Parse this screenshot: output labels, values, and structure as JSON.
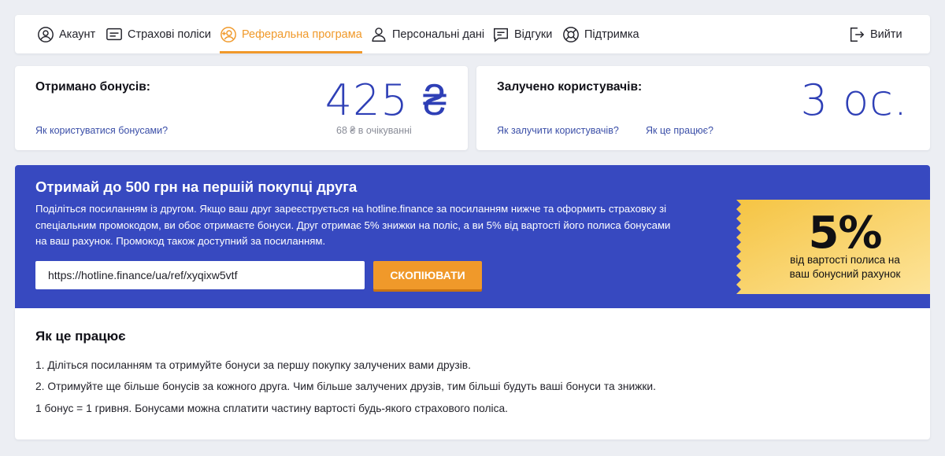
{
  "nav": {
    "items": [
      {
        "label": "Акаунт",
        "icon": "account-icon",
        "active": false
      },
      {
        "label": "Страхові поліси",
        "icon": "policies-icon",
        "active": false
      },
      {
        "label": "Реферальна програма",
        "icon": "referral-icon",
        "active": true
      },
      {
        "label": "Персональні дані",
        "icon": "person-icon",
        "active": false
      },
      {
        "label": "Відгуки",
        "icon": "reviews-icon",
        "active": false
      },
      {
        "label": "Підтримка",
        "icon": "support-icon",
        "active": false
      }
    ],
    "logout": {
      "label": "Вийти",
      "icon": "logout-icon"
    }
  },
  "bonuses": {
    "title": "Отримано бонусів:",
    "value": "425 ₴",
    "link": "Як користуватися бонусами?",
    "pending": "68 ₴ в очікуванні"
  },
  "referrals": {
    "title": "Залучено користувачів:",
    "value": "3 ос.",
    "link_invite": "Як залучити користувачів?",
    "link_how": "Як це працює?"
  },
  "promo": {
    "title": "Отримай до 500 грн на першій покупці друга",
    "text": "Поділіться посиланням із другом. Якщо ваш друг зареєструється на hotline.finance за посиланням нижче та оформить страховку зі спеціальним промокодом, ви обоє отримаєте бонуси. Друг отримає 5% знижки на поліс, а ви 5% від вартості його полиса бонусами на ваш рахунок. Промокод також доступний за посиланням.",
    "ref_link": "https://hotline.finance/ua/ref/xyqixw5vtf",
    "copy_label": "СКОПІЮВАТИ",
    "ticket_percent": "5%",
    "ticket_caption_1": "від вартості полиса на",
    "ticket_caption_2": "ваш бонусний рахунок"
  },
  "how": {
    "title": "Як це працює",
    "lines": [
      "1. Діліться посиланням та отримуйте бонуси за першу покупку залучених вами друзів.",
      "2. Отримуйте ще більше бонусів за кожного друга. Чим більше залучених друзів, тим більші будуть ваші бонуси та знижки.",
      "1 бонус = 1 гривня. Бонусами можна сплатити частину вартості будь-якого страхового поліса."
    ]
  },
  "colors": {
    "accent": "#f0992a",
    "primary_blue": "#3749c0",
    "number_blue": "#2e3fb6",
    "link_blue": "#3b4fa8",
    "background": "#eceef3",
    "ticket_gold": "#f6c94c"
  }
}
